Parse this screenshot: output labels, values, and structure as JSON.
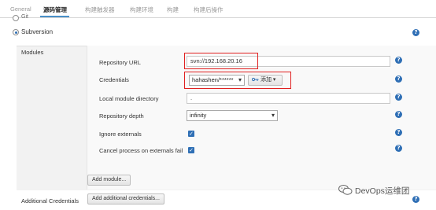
{
  "tabs": [
    {
      "label": "General"
    },
    {
      "label": "源码管理"
    },
    {
      "label": "构建触发器"
    },
    {
      "label": "构建环境"
    },
    {
      "label": "构建"
    },
    {
      "label": "构建后操作"
    }
  ],
  "scm": {
    "git_label": "Git",
    "svn_label": "Subversion",
    "selected": "Subversion"
  },
  "modules": {
    "section_label": "Modules",
    "repository_url_label": "Repository URL",
    "repository_url_value": "svn://192.168.20.16",
    "credentials_label": "Credentials",
    "credentials_value": "hahashen/******",
    "add_button_label": "添加",
    "local_dir_label": "Local module directory",
    "local_dir_value": ".",
    "depth_label": "Repository depth",
    "depth_value": "infinity",
    "ignore_externals_label": "Ignore externals",
    "ignore_externals_checked": true,
    "cancel_process_label": "Cancel process on externals fail",
    "cancel_process_checked": true,
    "add_module_label": "Add module..."
  },
  "additional_credentials": {
    "label": "Additional Credentials",
    "button_label": "Add additional credentials..."
  },
  "icons": {
    "help": "?",
    "check": "✓",
    "chevron": "▾",
    "key": "key-icon"
  },
  "watermark": "DevOps运维团",
  "colors": {
    "accent": "#2f6fb5",
    "highlight_border": "#e02020"
  }
}
